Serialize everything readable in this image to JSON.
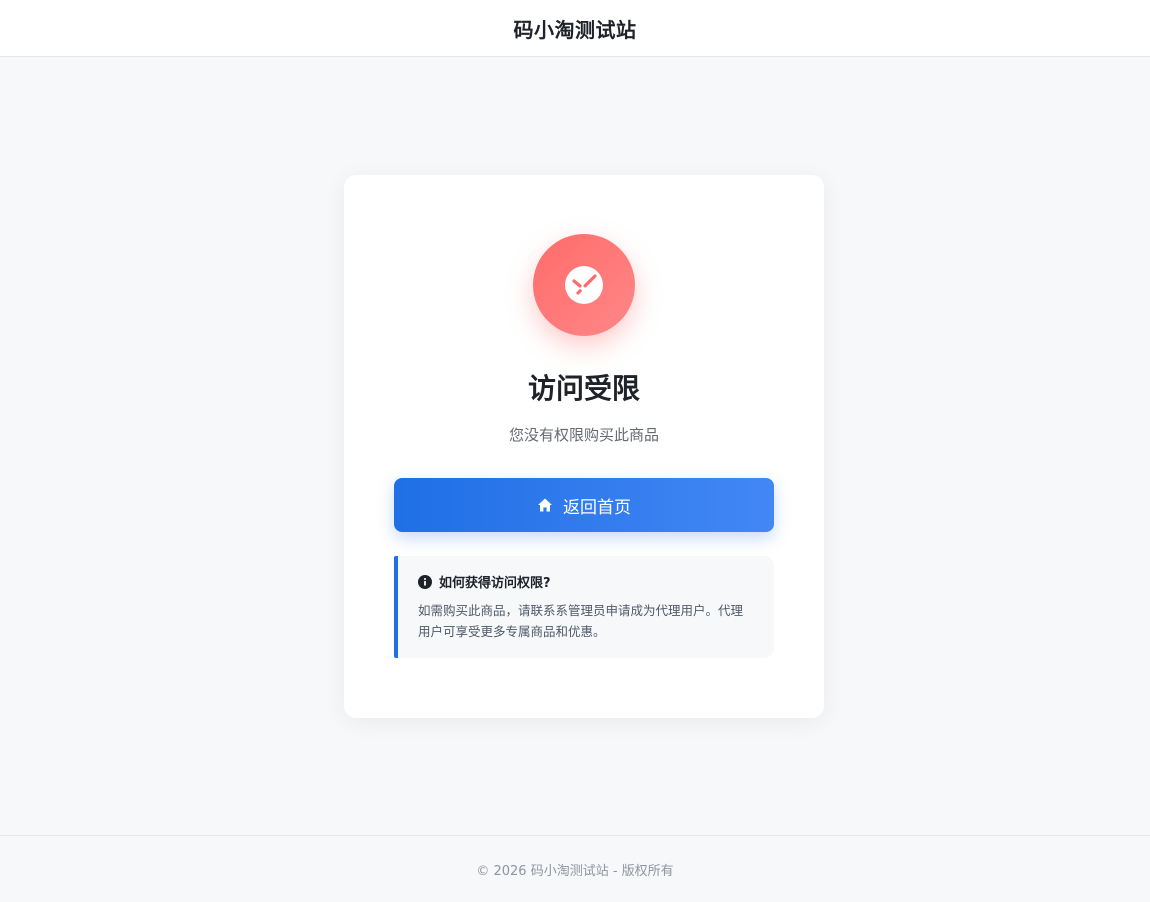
{
  "header": {
    "title": "码小淘测试站"
  },
  "card": {
    "status_icon": "blocked-icon",
    "title": "访问受限",
    "subtitle": "您没有权限购买此商品",
    "home_button": {
      "icon": "home-icon",
      "label": "返回首页"
    },
    "info": {
      "icon": "info-icon",
      "heading": "如何获得访问权限?",
      "text": "如需购买此商品，请联系系管理员申请成为代理用户。代理用户可享受更多专属商品和优惠。"
    }
  },
  "footer": {
    "text": "© 2026 码小淘测试站 - 版权所有"
  },
  "colors": {
    "accent": "#1f6fe5",
    "accent_light": "#4387f5",
    "error": "#ff6b6b",
    "background": "#f7f8fa",
    "text_primary": "#1f2329",
    "text_secondary": "#646a73"
  }
}
